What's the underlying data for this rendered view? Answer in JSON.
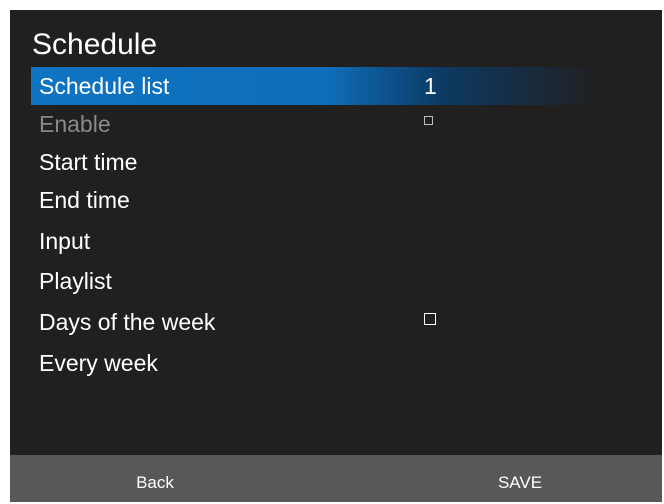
{
  "screen": {
    "title": "Schedule"
  },
  "menu": {
    "items": [
      {
        "label": "Schedule list",
        "value": "1",
        "selected": true,
        "disabled": false
      },
      {
        "label": "Enable",
        "checkbox": false,
        "disabled": true
      },
      {
        "label": "Start time"
      },
      {
        "label": "End time"
      },
      {
        "label": "Input"
      },
      {
        "label": "Playlist"
      },
      {
        "label": "Days of the week",
        "checkbox": false
      },
      {
        "label": "Every week"
      }
    ]
  },
  "footer": {
    "back_label": "Back",
    "save_label": "SAVE"
  },
  "colors": {
    "background": "#221f1f",
    "highlight": "#0f74c3",
    "footer": "#585858",
    "disabled_text": "#8a8888"
  }
}
